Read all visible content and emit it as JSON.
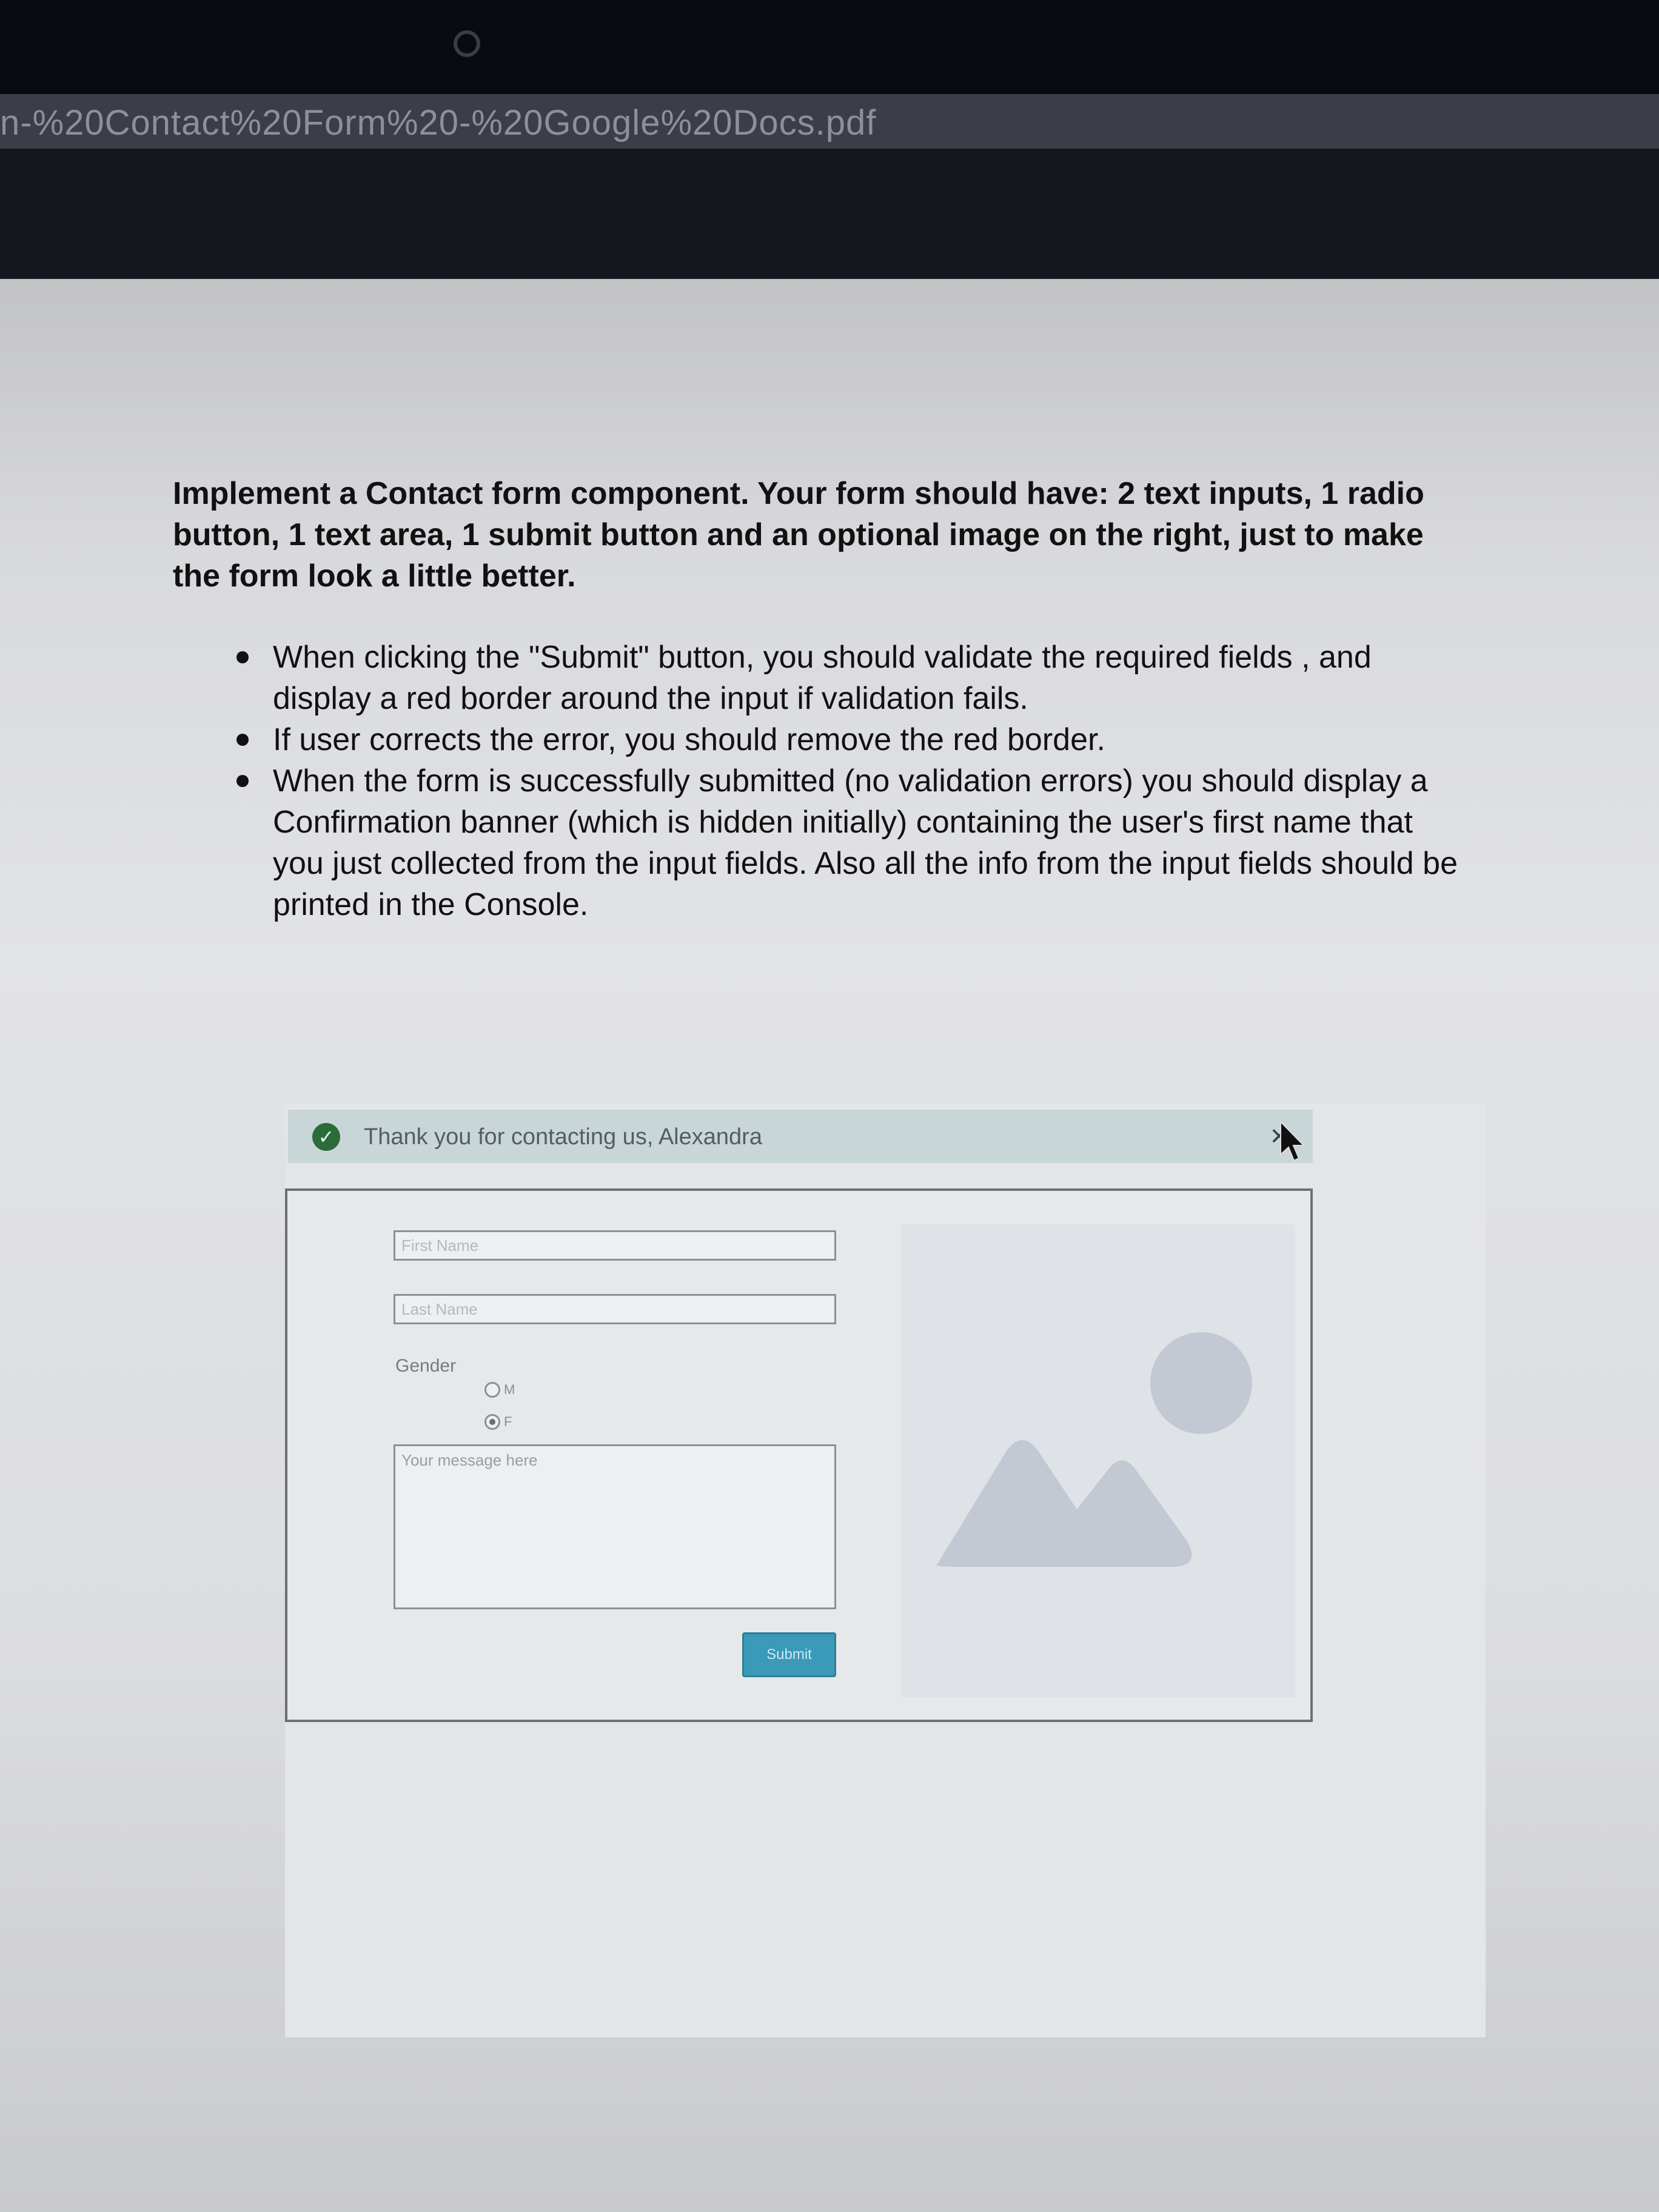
{
  "browser": {
    "url_fragment": "n-%20Contact%20Form%20-%20Google%20Docs.pdf"
  },
  "document": {
    "intro": "Implement a Contact form component. Your form should have: 2 text inputs, 1 radio button, 1 text area, 1 submit button and an optional image on the right, just to make the form look a little better.",
    "requirements": [
      "When clicking the \"Submit\" button, you should validate the required fields , and display a red border around the input if validation fails.",
      "If user corrects the error, you should remove the red border.",
      "When the form is successfully submitted (no validation errors) you should display a Confirmation banner (which is hidden initially) containing the user's first name that you just collected from the input fields. Also all the info from the input fields should be printed in the Console."
    ]
  },
  "demo": {
    "banner": {
      "text": "Thank you for contacting us, Alexandra",
      "close_glyph": "×",
      "check_glyph": "✓"
    },
    "form": {
      "first_name_placeholder": "First Name",
      "last_name_placeholder": "Last Name",
      "gender_label": "Gender",
      "radio_m_label": "M",
      "radio_f_label": "F",
      "selected_gender": "F",
      "message_placeholder": "Your message here",
      "submit_label": "Submit"
    }
  },
  "icons": {
    "check": "check-circle-icon",
    "close": "close-icon",
    "cursor": "mouse-pointer-icon",
    "image": "image-placeholder-icon"
  },
  "colors": {
    "banner_bg": "#c9d6d8",
    "check_green": "#2c6b3a",
    "submit_blue": "#3a9ab8",
    "image_shape": "#c3c9d3"
  }
}
